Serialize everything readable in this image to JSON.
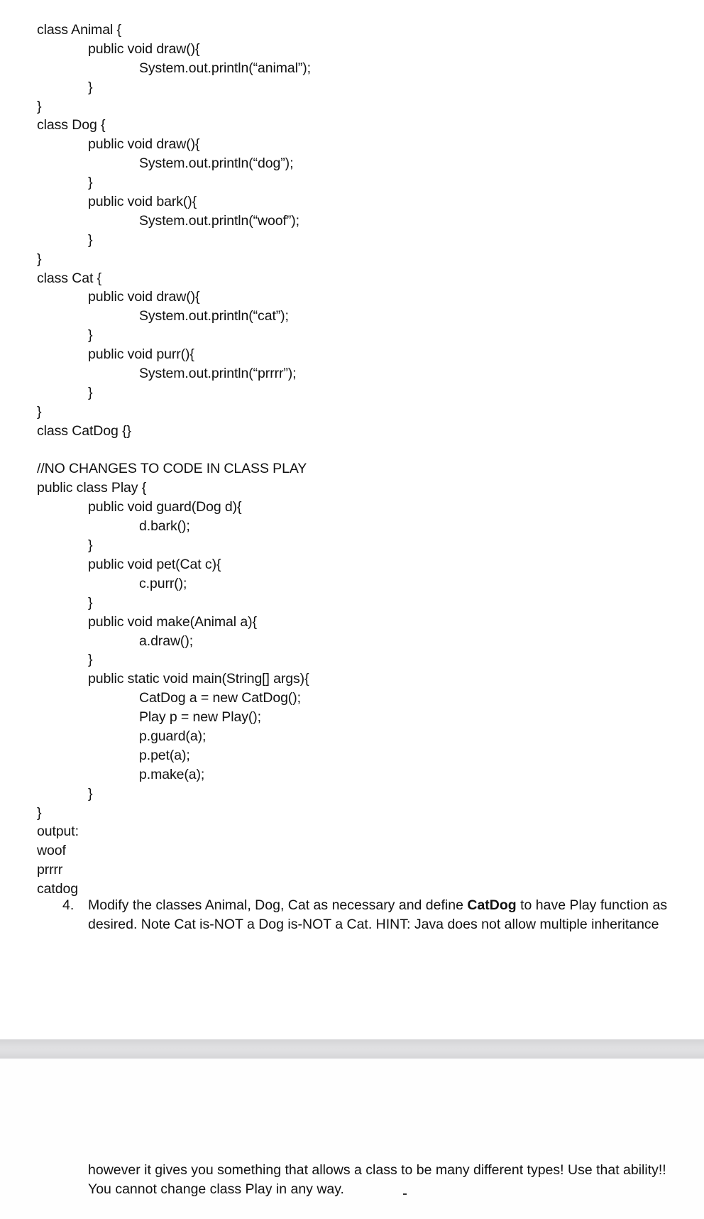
{
  "code_lines": [
    {
      "indent": 0,
      "text": "class Animal {"
    },
    {
      "indent": 1,
      "text": "public void draw(){"
    },
    {
      "indent": 2,
      "text": "System.out.println(“animal”);"
    },
    {
      "indent": 1,
      "text": "}"
    },
    {
      "indent": 0,
      "text": "}"
    },
    {
      "indent": 0,
      "text": "class Dog {"
    },
    {
      "indent": 1,
      "text": "public void draw(){"
    },
    {
      "indent": 2,
      "text": "System.out.println(“dog”);"
    },
    {
      "indent": 1,
      "text": "}"
    },
    {
      "indent": 1,
      "text": "public void bark(){"
    },
    {
      "indent": 2,
      "text": "System.out.println(“woof”);"
    },
    {
      "indent": 1,
      "text": "}"
    },
    {
      "indent": 0,
      "text": "}"
    },
    {
      "indent": 0,
      "text": "class Cat {"
    },
    {
      "indent": 1,
      "text": "public void draw(){"
    },
    {
      "indent": 2,
      "text": "System.out.println(“cat”);"
    },
    {
      "indent": 1,
      "text": "}"
    },
    {
      "indent": 1,
      "text": "public void purr(){"
    },
    {
      "indent": 2,
      "text": "System.out.println(“prrrr”);"
    },
    {
      "indent": 1,
      "text": "}"
    },
    {
      "indent": 0,
      "text": "}"
    },
    {
      "indent": 0,
      "text": "class CatDog {}"
    },
    {
      "indent": 0,
      "text": ""
    },
    {
      "indent": 0,
      "text": "//NO CHANGES TO CODE IN CLASS PLAY"
    },
    {
      "indent": 0,
      "text": "public class Play {"
    },
    {
      "indent": 1,
      "text": "public void guard(Dog d){"
    },
    {
      "indent": 2,
      "text": "d.bark();"
    },
    {
      "indent": 1,
      "text": "}"
    },
    {
      "indent": 1,
      "text": "public void pet(Cat c){"
    },
    {
      "indent": 2,
      "text": "c.purr();"
    },
    {
      "indent": 1,
      "text": "}"
    },
    {
      "indent": 1,
      "text": "public void make(Animal a){"
    },
    {
      "indent": 2,
      "text": "a.draw();"
    },
    {
      "indent": 1,
      "text": "}"
    },
    {
      "indent": 1,
      "text": "public static void main(String[] args){"
    },
    {
      "indent": 2,
      "text": "CatDog a = new CatDog();"
    },
    {
      "indent": 2,
      "text": "Play p = new Play();"
    },
    {
      "indent": 2,
      "text": "p.guard(a);"
    },
    {
      "indent": 2,
      "text": "p.pet(a);"
    },
    {
      "indent": 2,
      "text": "p.make(a);"
    },
    {
      "indent": 1,
      "text": "}"
    },
    {
      "indent": 0,
      "text": "}"
    },
    {
      "indent": 0,
      "text": "output:"
    },
    {
      "indent": 0,
      "text": "woof"
    },
    {
      "indent": 0,
      "text": "prrrr"
    },
    {
      "indent": 0,
      "text": "catdog"
    }
  ],
  "question": {
    "number": "4.",
    "text_before_bold": "Modify the classes Animal, Dog, Cat as necessary and define ",
    "bold_text": "CatDog",
    "text_after_bold": " to have Play function as desired. Note Cat is-NOT a Dog is-NOT a Cat. HINT: Java does not allow multiple inheritance"
  },
  "continuation": {
    "line1": "however it gives you something that allows a class to be many different types! Use that ability!!",
    "line2": "You cannot change class Play in any way."
  },
  "colors": {
    "text": "#111111",
    "separator": "#dfdfe1"
  }
}
